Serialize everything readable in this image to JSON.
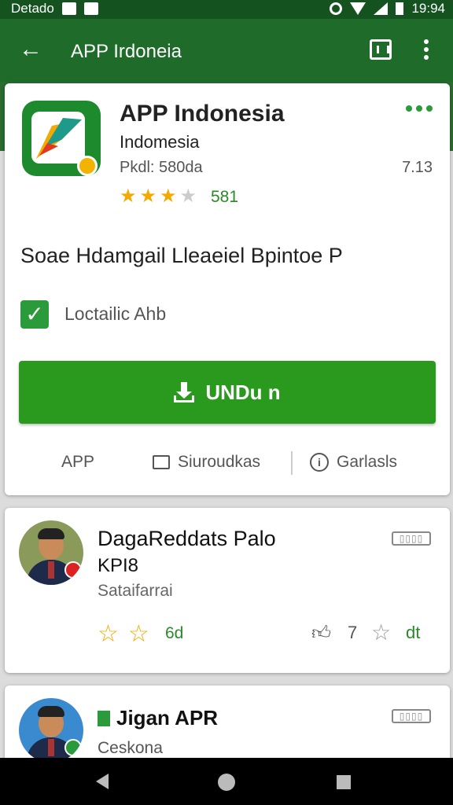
{
  "status_bar": {
    "carrier": "Detado",
    "time": "19:94"
  },
  "app_bar": {
    "back_icon": "arrow-left-icon",
    "title": "APP Irdoneia"
  },
  "app": {
    "name": "APP Indonesia",
    "developer": "Indomesia",
    "meta": "Pkdl: 580da",
    "count": "7.13",
    "rating_stars": 3,
    "rating_count": "581",
    "description": "Soae Hdamgail Lleaeiel Bpintoe P",
    "checkbox_label": "Loctailic Ahb",
    "install_label": "UNDu n",
    "tabs": {
      "app": "APP",
      "reviews": "Siuroudkas",
      "details": "Garlasls"
    }
  },
  "reviews": [
    {
      "name_line1": "DagaReddats Palo",
      "name_line2": "KPI8",
      "sub": "Sataifarrai",
      "tag": "▯▯▯▯",
      "stars": 2,
      "star_count": "6d",
      "likes": "7",
      "num": "dt"
    },
    {
      "name": "Jigan APR",
      "sub": "Ceskona",
      "tag": "▯▯▯▯"
    }
  ],
  "colors": {
    "app_bar": "#1f6b2a",
    "install": "#2a9a1e",
    "accent": "#f2a900"
  }
}
